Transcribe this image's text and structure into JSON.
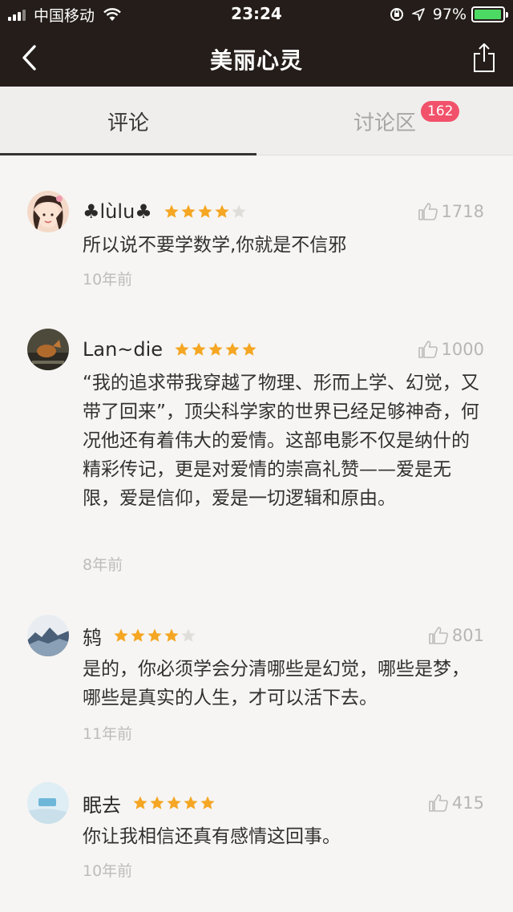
{
  "status_bar": {
    "carrier": "中国移动",
    "time": "23:24",
    "battery_percent": "97%",
    "battery_level": 0.97,
    "battery_color": "#4cd964"
  },
  "nav": {
    "title": "美丽心灵",
    "back_icon": "chevron-left-icon",
    "share_icon": "share-icon"
  },
  "tabs": [
    {
      "label": "评论",
      "active": true
    },
    {
      "label": "讨论区",
      "active": false,
      "badge": "162",
      "badge_color": "#f1516a"
    }
  ],
  "comments": [
    {
      "author": "♣lùlu♣",
      "rating": 4,
      "likes": "1718",
      "text": "所以说不要学数学,你就是不信邪",
      "time": "10年前"
    },
    {
      "author": "Lan~die",
      "rating": 5,
      "likes": "1000",
      "text": "“我的追求带我穿越了物理、形而上学、幻觉，又带了回来”，顶尖科学家的世界已经足够神奇，何况他还有着伟大的爱情。这部电影不仅是纳什的精彩传记，更是对爱情的崇高礼赞——爱是无限，爱是信仰，爱是一切逻辑和原由。",
      "time": "8年前"
    },
    {
      "author": "鸫",
      "rating": 4,
      "likes": "801",
      "text": "是的，你必须学会分清哪些是幻觉，哪些是梦，哪些是真实的人生，才可以活下去。",
      "time": "11年前"
    },
    {
      "author": "眠去",
      "rating": 5,
      "likes": "415",
      "text": "你让我相信还真有感情这回事。",
      "time": "10年前"
    }
  ],
  "colors": {
    "header_bg": "#241d19",
    "star_filled": "#f5a623",
    "star_empty": "#e0deda"
  }
}
